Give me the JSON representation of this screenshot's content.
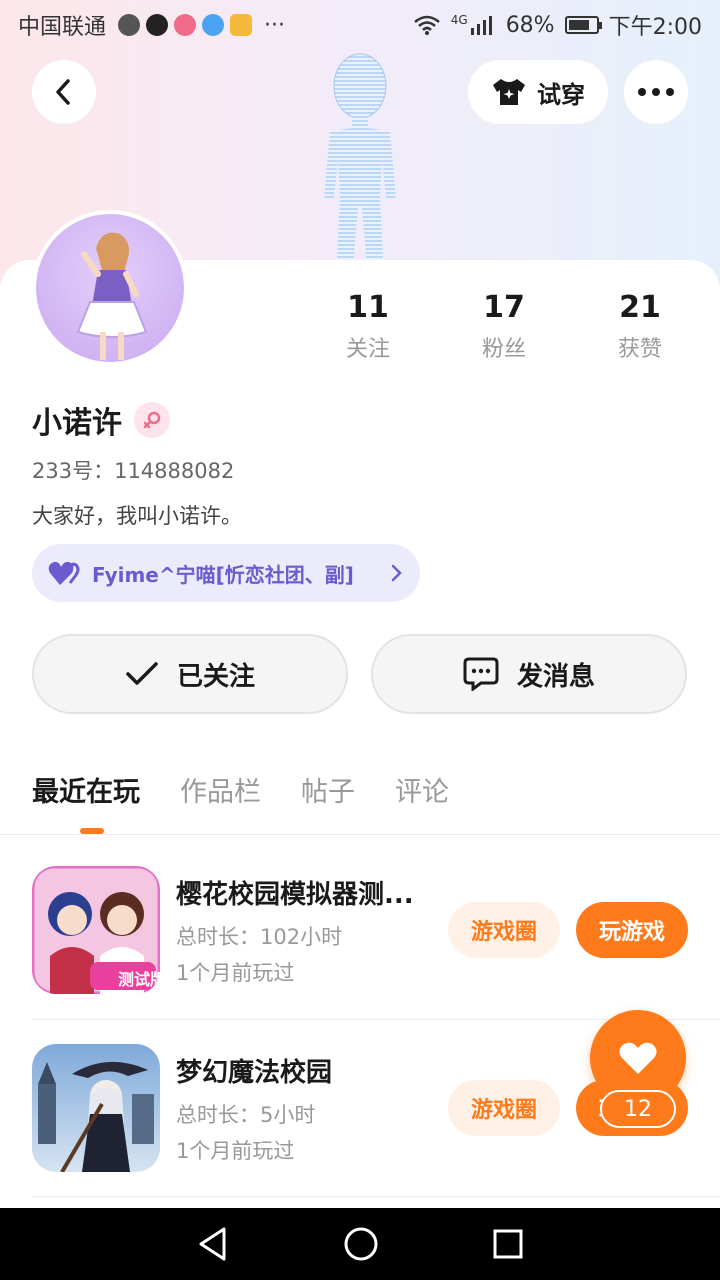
{
  "status_bar": {
    "carrier": "中国联通",
    "network": "4G",
    "battery": "68%",
    "time": "下午2:00",
    "more": "···"
  },
  "top_bar": {
    "try_on_label": "试穿"
  },
  "profile": {
    "name": "小诺许",
    "uid": "233号：114888082",
    "bio": "大家好，我叫小诺许。",
    "club": "Fyime^宁喵[忻恋社团、副]",
    "stats": [
      {
        "num": "11",
        "label": "关注"
      },
      {
        "num": "17",
        "label": "粉丝"
      },
      {
        "num": "21",
        "label": "获赞"
      }
    ]
  },
  "actions": {
    "follow_label": "已关注",
    "message_label": "发消息"
  },
  "tabs": [
    "最近在玩",
    "作品栏",
    "帖子",
    "评论"
  ],
  "games": [
    {
      "title": "樱花校园模拟器测...",
      "duration": "总时长：102小时",
      "last_played": "1个月前玩过",
      "icon_badge": "测试版"
    },
    {
      "title": "梦幻魔法校园",
      "duration": "总时长：5小时",
      "last_played": "1个月前玩过"
    }
  ],
  "game_buttons": {
    "circle": "游戏圈",
    "play": "玩游戏"
  },
  "fab": {
    "count": "12"
  },
  "colors": {
    "accent": "#ff7a1a",
    "club_text": "#6a5ccf"
  }
}
